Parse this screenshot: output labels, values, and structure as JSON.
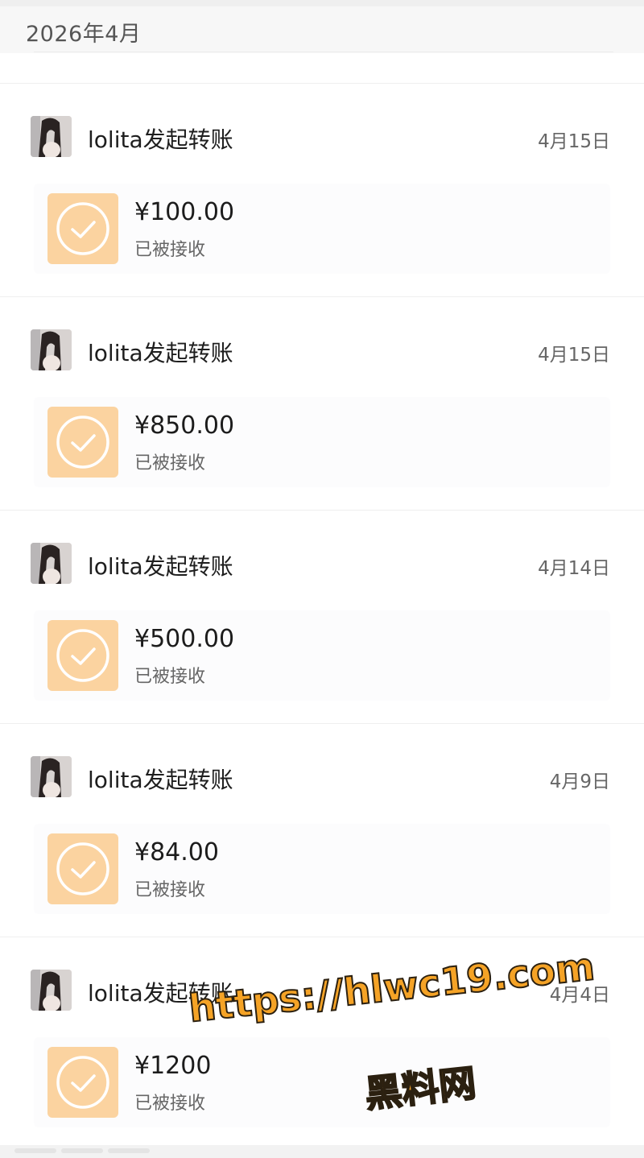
{
  "month_header": {
    "title": "2026年4月"
  },
  "transactions": [
    {
      "title": "lolita发起转账",
      "date": "4月15日",
      "amount": "¥100.00",
      "status": "已被接收"
    },
    {
      "title": "lolita发起转账",
      "date": "4月15日",
      "amount": "¥850.00",
      "status": "已被接收"
    },
    {
      "title": "lolita发起转账",
      "date": "4月14日",
      "amount": "¥500.00",
      "status": "已被接收"
    },
    {
      "title": "lolita发起转账",
      "date": "4月9日",
      "amount": "¥84.00",
      "status": "已被接收"
    },
    {
      "title": "lolita发起转账",
      "date": "4月4日",
      "amount": "¥1200",
      "status": "已被接收"
    }
  ],
  "watermark": {
    "url": "https://hlwc19.com",
    "name": "黑料网"
  },
  "colors": {
    "icon_bg": "#fbd3a0",
    "watermark": "#f5a326"
  },
  "icons": {
    "avatar": "avatar-photo",
    "payment": "check-circle-icon"
  }
}
